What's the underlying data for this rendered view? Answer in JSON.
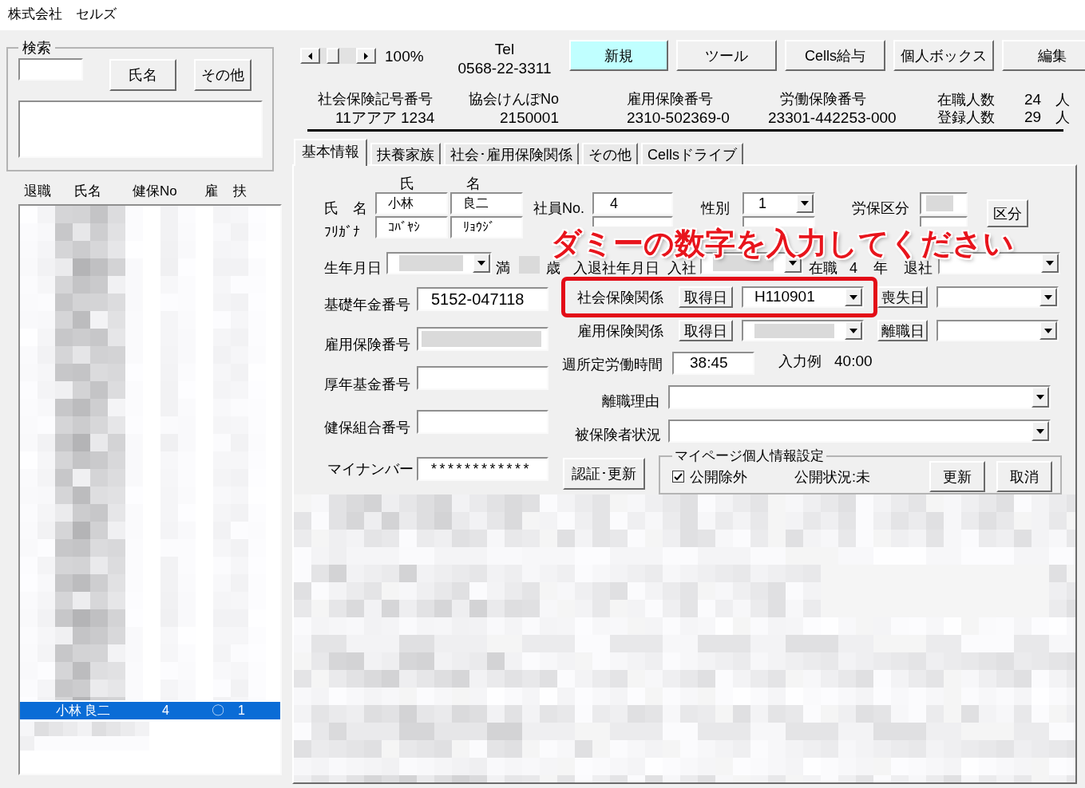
{
  "window": {
    "title": "株式会社　セルズ"
  },
  "search": {
    "legend": "検索",
    "buttons": [
      "氏名",
      "その他"
    ]
  },
  "employee_list": {
    "columns": [
      "退職",
      "氏名",
      "健保No",
      "雇",
      "扶"
    ],
    "rows": [
      {
        "name": "小林 良二",
        "health_insurance_no": "4",
        "employment_insurance": "〇",
        "dependents": "1",
        "selected": true
      }
    ]
  },
  "zoom": {
    "value": "100%"
  },
  "phone": {
    "label": "Tel",
    "number": "0568-22-3311"
  },
  "toolbar": [
    {
      "label": "新規",
      "highlighted": true
    },
    {
      "label": "ツール",
      "highlighted": false
    },
    {
      "label": "Cells給与",
      "highlighted": false
    },
    {
      "label": "個人ボックス",
      "highlighted": false
    },
    {
      "label": "編集",
      "highlighted": false
    }
  ],
  "company_numbers": [
    {
      "label": "社会保険記号番号",
      "value": "11アアア 1234"
    },
    {
      "label": "協会けんぽNo",
      "value": "2150001"
    },
    {
      "label": "雇用保険番号",
      "value": "2310-502369-0"
    },
    {
      "label": "労働保険番号",
      "value": "23301-442253-000"
    }
  ],
  "headcounts": [
    {
      "label": "在職人数",
      "value": "24",
      "unit": "人"
    },
    {
      "label": "登録人数",
      "value": "29",
      "unit": "人"
    }
  ],
  "tabs": [
    {
      "label": "基本情報",
      "selected": true
    },
    {
      "label": "扶養家族",
      "selected": false
    },
    {
      "label": "社会･雇用保険関係",
      "selected": false
    },
    {
      "label": "その他",
      "selected": false
    },
    {
      "label": "Cellsドライブ",
      "selected": false
    }
  ],
  "basic_info": {
    "name_headers": [
      "氏",
      "名"
    ],
    "name": {
      "label": "氏　名",
      "family": "小林",
      "given": "良二"
    },
    "furigana": {
      "label": "ﾌﾘｶﾞﾅ",
      "family": "ｺﾊﾞﾔｼ",
      "given": "ﾘｮｳｼﾞ"
    },
    "employee_no": {
      "label": "社員No.",
      "value": "4"
    },
    "gender": {
      "label": "性別",
      "value": "1"
    },
    "labor_insurance_class": {
      "label": "労保区分"
    },
    "class_button": "区分",
    "birth_date": {
      "label": "生年月日",
      "age_prefix": "満",
      "age_suffix": "歳"
    },
    "employment_dates": {
      "label": "入退社年月日",
      "join_label": "入社",
      "tenure_label": "在職",
      "tenure": "4",
      "tenure_unit": "年",
      "leave_label": "退社"
    },
    "number_fields": [
      {
        "label": "基礎年金番号",
        "value": "5152-047118",
        "redacted": false
      },
      {
        "label": "雇用保険番号",
        "redacted": true
      },
      {
        "label": "厚年基金番号",
        "redacted": false
      },
      {
        "label": "健保組合番号",
        "redacted": false
      },
      {
        "label": "マイナンバー",
        "value": "************",
        "redacted": false
      }
    ],
    "insurance_rows": [
      {
        "label": "社会保険関係",
        "acquire_button": "取得日",
        "acquire_date": "H110901",
        "end_button": "喪失日",
        "highlighted": true
      },
      {
        "label": "雇用保険関係",
        "acquire_button": "取得日",
        "end_button": "離職日",
        "highlighted": false
      }
    ],
    "weekly_hours": {
      "label": "週所定労働時間",
      "value": "38:45",
      "example_label": "入力例",
      "example_value": "40:00"
    },
    "leave_reason": {
      "label": "離職理由"
    },
    "insured_status": {
      "label": "被保険者状況"
    },
    "auth_button": "認証･更新",
    "my_page": {
      "legend": "マイページ個人情報設定",
      "exclude": {
        "label": "公開除外",
        "checked": true
      },
      "status": "公開状況:未",
      "buttons": [
        "更新",
        "取消"
      ]
    }
  },
  "annotation": "ダミーの数字を入力してください"
}
